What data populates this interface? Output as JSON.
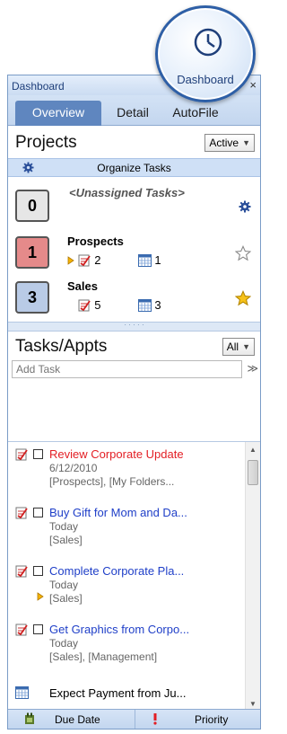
{
  "bubble": {
    "label": "Dashboard"
  },
  "panel": {
    "title": "Dashboard",
    "close_glyph": "×",
    "tabs": [
      {
        "label": "Overview",
        "active": true
      },
      {
        "label": "Detail",
        "active": false
      },
      {
        "label": "AutoFile",
        "active": false
      }
    ]
  },
  "projects": {
    "title": "Projects",
    "filter": "Active",
    "organize_label": "Organize Tasks",
    "items": [
      {
        "number": "0",
        "name": "<Unassigned Tasks>",
        "color": "#e6e6e6",
        "icon": "gear-icon"
      },
      {
        "number": "1",
        "name": "Prospects",
        "task_count": "2",
        "appt_count": "1",
        "color": "#e58a8a",
        "icon": "star-outline-icon"
      },
      {
        "number": "3",
        "name": "Sales",
        "task_count": "5",
        "appt_count": "3",
        "color": "#b9cbe6",
        "icon": "star-filled-icon"
      }
    ]
  },
  "tasks": {
    "title": "Tasks/Appts",
    "filter": "All",
    "add_placeholder": "Add Task",
    "items": [
      {
        "subject": "Review Corporate Update",
        "due": "6/12/2010",
        "projects": "[Prospects], [My Folders...",
        "color": "#e31e24",
        "flag": false
      },
      {
        "subject": "Buy Gift for Mom and Da...",
        "due": "Today",
        "projects": "[Sales]",
        "color": "#1f3fc8",
        "flag": false
      },
      {
        "subject": "Complete Corporate Pla...",
        "due": "Today",
        "projects": "[Sales]",
        "color": "#1f3fc8",
        "flag": true
      },
      {
        "subject": "Get Graphics from Corpo...",
        "due": "Today",
        "projects": "[Sales], [Management]",
        "color": "#1f3fc8",
        "flag": false
      },
      {
        "subject": "Expect Payment from Ju...",
        "type": "appointment",
        "color": "#000000"
      }
    ]
  },
  "bottom": {
    "due_date_label": "Due Date",
    "priority_label": "Priority"
  },
  "colors": {
    "accent": "#5f86bf",
    "header": "#cfe0f6",
    "border": "#7a9cc7",
    "overdue": "#e31e24",
    "today": "#1f3fc8"
  }
}
